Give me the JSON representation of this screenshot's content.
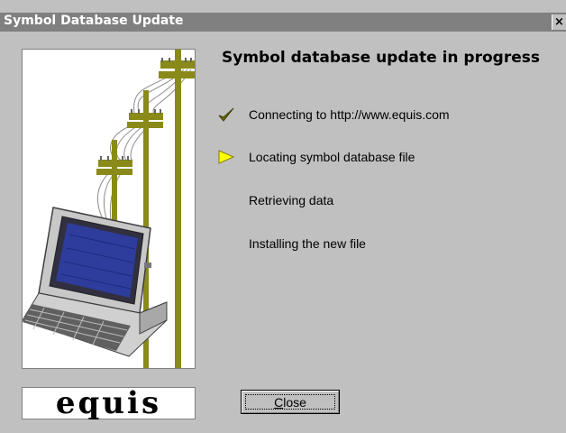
{
  "window": {
    "title": "Symbol Database Update",
    "close_glyph": "×"
  },
  "main": {
    "heading": "Symbol database update in progress",
    "steps": [
      {
        "label": "Connecting to http://www.equis.com",
        "status": "done",
        "icon": "checkmark-icon"
      },
      {
        "label": "Locating symbol database file",
        "status": "current",
        "icon": "arrow-right-icon"
      },
      {
        "label": "Retrieving data",
        "status": "pending",
        "icon": ""
      },
      {
        "label": "Installing the new file",
        "status": "pending",
        "icon": ""
      }
    ]
  },
  "logo": {
    "text": "equis"
  },
  "buttons": {
    "close_label": "Close"
  },
  "colors": {
    "dialog_bg": "#c0c0c0",
    "titlebar": "#808080",
    "checkmark": "#6b6b00",
    "arrow_fill": "#ffff00",
    "pole": "#8a8a1a"
  }
}
